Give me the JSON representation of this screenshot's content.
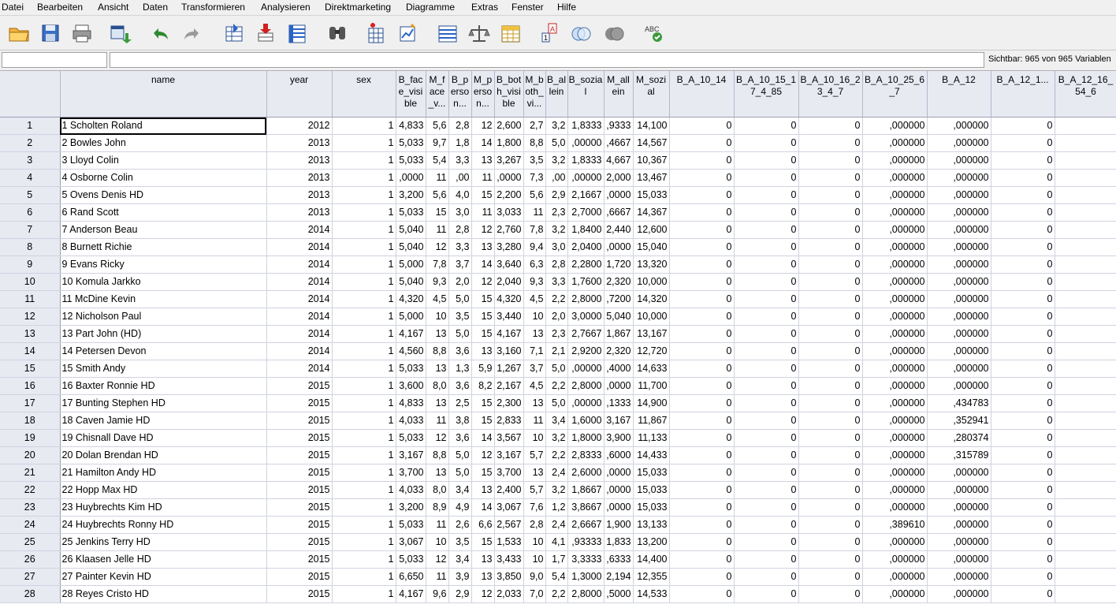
{
  "menu": [
    "Datei",
    "Bearbeiten",
    "Ansicht",
    "Daten",
    "Transformieren",
    "Analysieren",
    "Direktmarketing",
    "Diagramme",
    "Extras",
    "Fenster",
    "Hilfe"
  ],
  "toolbar": [
    "open-folder-icon",
    "save-icon",
    "print-icon",
    "recall-dialog-icon",
    "undo-icon",
    "redo-icon",
    "goto-case-icon",
    "goto-variable-icon",
    "variables-icon",
    "find-icon",
    "insert-cases-icon",
    "insert-variable-icon",
    "split-file-icon",
    "weight-cases-icon",
    "select-cases-icon",
    "value-labels-icon",
    "use-sets-icon",
    "show-sets-icon",
    "spelling-icon"
  ],
  "cellbar": {
    "ref": "",
    "value": "",
    "visible": "Sichtbar: 965 von 965 Variablen"
  },
  "columns": [
    "name",
    "year",
    "sex",
    "B_face_visible",
    "M_face_v...",
    "B_person...",
    "M_person...",
    "B_both_visible",
    "M_both_vi...",
    "B_allein",
    "B_sozial",
    "M_allein",
    "M_sozial",
    "B_A_10_14",
    "B_A_10_15_17_4_85",
    "B_A_10_16_23_4_7",
    "B_A_10_25_6_7",
    "B_A_12",
    "B_A_12_1...",
    "B_A_12_16_54_6"
  ],
  "rows": [
    [
      "1",
      "1 Scholten  Roland",
      "2012",
      "1",
      "4,833",
      "5,6",
      "2,8",
      "12",
      "2,600",
      "2,7",
      "3,2",
      "1,8333",
      ",9333",
      "14,100",
      "0",
      "0",
      "0",
      ",000000",
      ",000000",
      "0",
      ""
    ],
    [
      "2",
      "2 Bowles  John",
      "2013",
      "1",
      "5,033",
      "9,7",
      "1,8",
      "14",
      "1,800",
      "8,8",
      "5,0",
      ",00000",
      ",4667",
      "14,567",
      "0",
      "0",
      "0",
      ",000000",
      ",000000",
      "0",
      ""
    ],
    [
      "3",
      "3 Lloyd  Colin",
      "2013",
      "1",
      "5,033",
      "5,4",
      "3,3",
      "13",
      "3,267",
      "3,5",
      "3,2",
      "1,8333",
      "4,667",
      "10,367",
      "0",
      "0",
      "0",
      ",000000",
      ",000000",
      "0",
      ""
    ],
    [
      "4",
      "4 Osborne  Colin",
      "2013",
      "1",
      ",0000",
      "11",
      ",00",
      "11",
      ",0000",
      "7,3",
      ",00",
      ",00000",
      "2,000",
      "13,467",
      "0",
      "0",
      "0",
      ",000000",
      ",000000",
      "0",
      ""
    ],
    [
      "5",
      "5 Ovens  Denis HD",
      "2013",
      "1",
      "3,200",
      "5,6",
      "4,0",
      "15",
      "2,200",
      "5,6",
      "2,9",
      "2,1667",
      ",0000",
      "15,033",
      "0",
      "0",
      "0",
      ",000000",
      ",000000",
      "0",
      ""
    ],
    [
      "6",
      "6 Rand  Scott",
      "2013",
      "1",
      "5,033",
      "15",
      "3,0",
      "11",
      "3,033",
      "11",
      "2,3",
      "2,7000",
      ",6667",
      "14,367",
      "0",
      "0",
      "0",
      ",000000",
      ",000000",
      "0",
      ""
    ],
    [
      "7",
      "7 Anderson  Beau",
      "2014",
      "1",
      "5,040",
      "11",
      "2,8",
      "12",
      "2,760",
      "7,8",
      "3,2",
      "1,8400",
      "2,440",
      "12,600",
      "0",
      "0",
      "0",
      ",000000",
      ",000000",
      "0",
      ""
    ],
    [
      "8",
      "8 Burnett  Richie",
      "2014",
      "1",
      "5,040",
      "12",
      "3,3",
      "13",
      "3,280",
      "9,4",
      "3,0",
      "2,0400",
      ",0000",
      "15,040",
      "0",
      "0",
      "0",
      ",000000",
      ",000000",
      "0",
      ""
    ],
    [
      "9",
      "9 Evans  Ricky",
      "2014",
      "1",
      "5,000",
      "7,8",
      "3,7",
      "14",
      "3,640",
      "6,3",
      "2,8",
      "2,2800",
      "1,720",
      "13,320",
      "0",
      "0",
      "0",
      ",000000",
      ",000000",
      "0",
      ""
    ],
    [
      "10",
      "10 Komula  Jarkko",
      "2014",
      "1",
      "5,040",
      "9,3",
      "2,0",
      "12",
      "2,040",
      "9,3",
      "3,3",
      "1,7600",
      "2,320",
      "10,000",
      "0",
      "0",
      "0",
      ",000000",
      ",000000",
      "0",
      ""
    ],
    [
      "11",
      "11 McDine  Kevin",
      "2014",
      "1",
      "4,320",
      "4,5",
      "5,0",
      "15",
      "4,320",
      "4,5",
      "2,2",
      "2,8000",
      ",7200",
      "14,320",
      "0",
      "0",
      "0",
      ",000000",
      ",000000",
      "0",
      ""
    ],
    [
      "12",
      "12 Nicholson  Paul",
      "2014",
      "1",
      "5,000",
      "10",
      "3,5",
      "15",
      "3,440",
      "10",
      "2,0",
      "3,0000",
      "5,040",
      "10,000",
      "0",
      "0",
      "0",
      ",000000",
      ",000000",
      "0",
      ""
    ],
    [
      "13",
      "13 Part  John (HD)",
      "2014",
      "1",
      "4,167",
      "13",
      "5,0",
      "15",
      "4,167",
      "13",
      "2,3",
      "2,7667",
      "1,867",
      "13,167",
      "0",
      "0",
      "0",
      ",000000",
      ",000000",
      "0",
      ""
    ],
    [
      "14",
      "14 Petersen  Devon",
      "2014",
      "1",
      "4,560",
      "8,8",
      "3,6",
      "13",
      "3,160",
      "7,1",
      "2,1",
      "2,9200",
      "2,320",
      "12,720",
      "0",
      "0",
      "0",
      ",000000",
      ",000000",
      "0",
      ""
    ],
    [
      "15",
      "15 Smith  Andy",
      "2014",
      "1",
      "5,033",
      "13",
      "1,3",
      "5,9",
      "1,267",
      "3,7",
      "5,0",
      ",00000",
      ",4000",
      "14,633",
      "0",
      "0",
      "0",
      ",000000",
      ",000000",
      "0",
      ""
    ],
    [
      "16",
      "16 Baxter  Ronnie HD",
      "2015",
      "1",
      "3,600",
      "8,0",
      "3,6",
      "8,2",
      "2,167",
      "4,5",
      "2,2",
      "2,8000",
      ",0000",
      "11,700",
      "0",
      "0",
      "0",
      ",000000",
      ",000000",
      "0",
      ""
    ],
    [
      "17",
      "17 Bunting  Stephen HD",
      "2015",
      "1",
      "4,833",
      "13",
      "2,5",
      "15",
      "2,300",
      "13",
      "5,0",
      ",00000",
      ",1333",
      "14,900",
      "0",
      "0",
      "0",
      ",000000",
      ",434783",
      "0",
      ""
    ],
    [
      "18",
      "18 Caven  Jamie HD",
      "2015",
      "1",
      "4,033",
      "11",
      "3,8",
      "15",
      "2,833",
      "11",
      "3,4",
      "1,6000",
      "3,167",
      "11,867",
      "0",
      "0",
      "0",
      ",000000",
      ",352941",
      "0",
      ""
    ],
    [
      "19",
      "19 Chisnall  Dave HD",
      "2015",
      "1",
      "5,033",
      "12",
      "3,6",
      "14",
      "3,567",
      "10",
      "3,2",
      "1,8000",
      "3,900",
      "11,133",
      "0",
      "0",
      "0",
      ",000000",
      ",280374",
      "0",
      ""
    ],
    [
      "20",
      "20 Dolan  Brendan HD",
      "2015",
      "1",
      "3,167",
      "8,8",
      "5,0",
      "12",
      "3,167",
      "5,7",
      "2,2",
      "2,8333",
      ",6000",
      "14,433",
      "0",
      "0",
      "0",
      ",000000",
      ",315789",
      "0",
      ""
    ],
    [
      "21",
      "21 Hamilton  Andy HD",
      "2015",
      "1",
      "3,700",
      "13",
      "5,0",
      "15",
      "3,700",
      "13",
      "2,4",
      "2,6000",
      ",0000",
      "15,033",
      "0",
      "0",
      "0",
      ",000000",
      ",000000",
      "0",
      ""
    ],
    [
      "22",
      "22 Hopp  Max HD",
      "2015",
      "1",
      "4,033",
      "8,0",
      "3,4",
      "13",
      "2,400",
      "5,7",
      "3,2",
      "1,8667",
      ",0000",
      "15,033",
      "0",
      "0",
      "0",
      ",000000",
      ",000000",
      "0",
      ""
    ],
    [
      "23",
      "23 Huybrechts  Kim HD",
      "2015",
      "1",
      "3,200",
      "8,9",
      "4,9",
      "14",
      "3,067",
      "7,6",
      "1,2",
      "3,8667",
      ",0000",
      "15,033",
      "0",
      "0",
      "0",
      ",000000",
      ",000000",
      "0",
      ""
    ],
    [
      "24",
      "24 Huybrechts  Ronny HD",
      "2015",
      "1",
      "5,033",
      "11",
      "2,6",
      "6,6",
      "2,567",
      "2,8",
      "2,4",
      "2,6667",
      "1,900",
      "13,133",
      "0",
      "0",
      "0",
      ",389610",
      ",000000",
      "0",
      ""
    ],
    [
      "25",
      "25 Jenkins  Terry HD",
      "2015",
      "1",
      "3,067",
      "10",
      "3,5",
      "15",
      "1,533",
      "10",
      "4,1",
      ",93333",
      "1,833",
      "13,200",
      "0",
      "0",
      "0",
      ",000000",
      ",000000",
      "0",
      ""
    ],
    [
      "26",
      "26 Klaasen  Jelle HD",
      "2015",
      "1",
      "5,033",
      "12",
      "3,4",
      "13",
      "3,433",
      "10",
      "1,7",
      "3,3333",
      ",6333",
      "14,400",
      "0",
      "0",
      "0",
      ",000000",
      ",000000",
      "0",
      ""
    ],
    [
      "27",
      "27 Painter  Kevin HD",
      "2015",
      "1",
      "6,650",
      "11",
      "3,9",
      "13",
      "3,850",
      "9,0",
      "5,4",
      "1,3000",
      "2,194",
      "12,355",
      "0",
      "0",
      "0",
      ",000000",
      ",000000",
      "0",
      ""
    ],
    [
      "28",
      "28 Reyes  Cristo HD",
      "2015",
      "1",
      "4,167",
      "9,6",
      "2,9",
      "12",
      "2,033",
      "7,0",
      "2,2",
      "2,8000",
      ",5000",
      "14,533",
      "0",
      "0",
      "0",
      ",000000",
      ",000000",
      "0",
      ""
    ]
  ]
}
